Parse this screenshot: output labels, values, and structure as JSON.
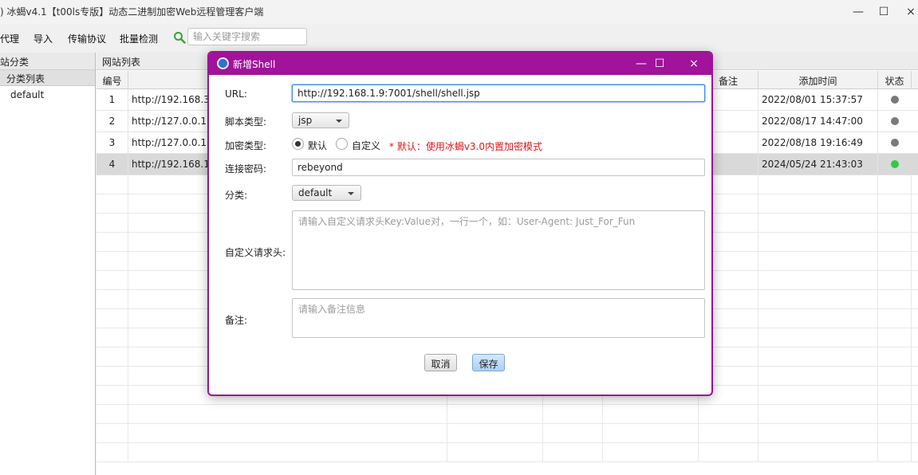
{
  "window": {
    "title": ") 冰蝎v4.1【t00ls专版】动态二进制加密Web远程管理客户端",
    "minimize": "—",
    "maximize": "☐",
    "close": "×"
  },
  "menu": {
    "items": [
      "代理",
      "导入",
      "传输协议",
      "批量检测"
    ],
    "search_placeholder": "输入关键字搜索"
  },
  "left_panel": {
    "header": "站分类",
    "sub_header": "分类列表",
    "items": [
      "default"
    ]
  },
  "main": {
    "header": "网站列表",
    "columns": [
      "编号",
      "",
      "",
      "",
      "",
      "备注",
      "添加时间",
      "状态"
    ],
    "rows": [
      {
        "id": "1",
        "url": "http://192.168.3.2",
        "time": "2022/08/01 15:37:57",
        "status": "gray"
      },
      {
        "id": "2",
        "url": "http://127.0.0.1:70",
        "time": "2022/08/17 14:47:00",
        "status": "gray"
      },
      {
        "id": "3",
        "url": "http://127.0.0.1:80",
        "time": "2022/08/18 19:16:49",
        "status": "gray"
      },
      {
        "id": "4",
        "url": "http://192.168.1.4",
        "time": "2024/05/24 21:43:03",
        "status": "green"
      }
    ]
  },
  "dialog": {
    "title": "新增Shell",
    "minimize": "—",
    "maximize": "☐",
    "close": "×",
    "url_label": "URL:",
    "url_value": "http://192.168.1.9:7001/shell/shell.jsp",
    "script_type_label": "脚本类型:",
    "script_type_value": "jsp",
    "encrypt_label": "加密类型:",
    "encrypt_options": [
      "默认",
      "自定义"
    ],
    "encrypt_selected": "默认",
    "encrypt_hint": "* 默认：使用冰蝎v3.0内置加密模式",
    "password_label": "连接密码:",
    "password_value": "rebeyond",
    "category_label": "分类:",
    "category_value": "default",
    "headers_label": "自定义请求头:",
    "headers_placeholder": "请输入自定义请求头Key:Value对，一行一个，如：User-Agent: Just_For_Fun",
    "remark_label": "备注:",
    "remark_placeholder": "请输入备注信息",
    "cancel_label": "取消",
    "save_label": "保存"
  },
  "colors": {
    "dialog_titlebar": "#a1139a",
    "highlight": "#e62727",
    "status_gray": "#7a7a7a",
    "status_green": "#2ecc40",
    "hint_text": "#e0161a"
  }
}
